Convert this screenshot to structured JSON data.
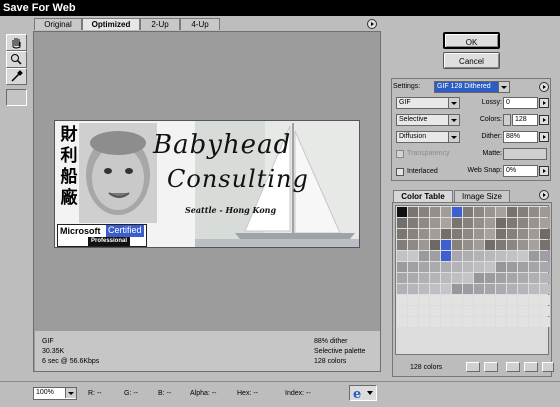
{
  "window": {
    "title": "Save For Web"
  },
  "tabs": [
    {
      "label": "Original",
      "active": false
    },
    {
      "label": "Optimized",
      "active": true
    },
    {
      "label": "2-Up",
      "active": false
    },
    {
      "label": "4-Up",
      "active": false
    }
  ],
  "tools": [
    "hand-tool-icon",
    "zoom-tool-icon",
    "eyedropper-tool-icon",
    "color-swatch"
  ],
  "preview": {
    "chinese": [
      "財",
      "利",
      "船",
      "廠"
    ],
    "line1": "Babyhead",
    "line2": "Consulting",
    "location": "Seattle - Hong Kong",
    "ms_microsoft": "Microsoft",
    "ms_certified": "Certified",
    "ms_professional": "Professional"
  },
  "image_info": {
    "format": "GIF",
    "size": "30.35K",
    "time": "6 sec @ 56.6Kbps",
    "dither": "88% dither",
    "palette": "Selective palette",
    "colors": "128 colors"
  },
  "buttons": {
    "ok": "OK",
    "cancel": "Cancel"
  },
  "settings": {
    "label": "Settings:",
    "preset": "GIF 128 Dithered",
    "format": "GIF",
    "reduction": "Selective",
    "dither_algo": "Diffusion",
    "transparency_label": "Transparency",
    "interlaced_label": "Interlaced",
    "lossy_label": "Lossy:",
    "lossy_value": "0",
    "colors_label": "Colors:",
    "colors_value": "128",
    "dither_label": "Dither:",
    "dither_value": "88%",
    "matte_label": "Matte:",
    "websnap_label": "Web Snap:",
    "websnap_value": "0%"
  },
  "color_table": {
    "tab_colors": "Color Table",
    "tab_size": "Image Size",
    "count": "128 colors"
  },
  "statusbar": {
    "zoom": "100%",
    "r": "R: --",
    "g": "G: --",
    "b": "B: --",
    "alpha": "Alpha: --",
    "hex": "Hex: --",
    "index": "Index: --"
  },
  "colors": {
    "accent": "#3a5fcd",
    "canvas": "#9c9c9c",
    "chrome": "#bdbdbd"
  }
}
